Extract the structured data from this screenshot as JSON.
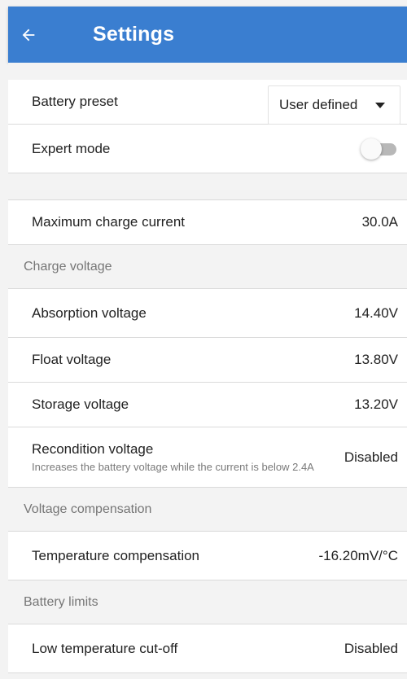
{
  "header": {
    "title": "Settings",
    "back_icon": "arrow-left-icon"
  },
  "colors": {
    "app_bar": "#3a7ed0",
    "section_bg": "#f3f3f3",
    "toggle_off": "#b8b8b8"
  },
  "general": {
    "battery_preset": {
      "label": "Battery preset",
      "value": "User defined",
      "icon": "caret-down-icon"
    },
    "expert_mode": {
      "label": "Expert mode",
      "state": "off"
    }
  },
  "current": {
    "max_charge_current": {
      "label": "Maximum charge current",
      "value": "30.0A"
    }
  },
  "charge_voltage": {
    "header": "Charge voltage",
    "absorption": {
      "label": "Absorption voltage",
      "value": "14.40V"
    },
    "float": {
      "label": "Float voltage",
      "value": "13.80V"
    },
    "storage": {
      "label": "Storage voltage",
      "value": "13.20V"
    },
    "recondition": {
      "label": "Recondition voltage",
      "description": "Increases the battery voltage while the current is below 2.4A",
      "value": "Disabled"
    }
  },
  "voltage_compensation": {
    "header": "Voltage compensation",
    "temperature": {
      "label": "Temperature compensation",
      "value": "-16.20mV/°C"
    }
  },
  "battery_limits": {
    "header": "Battery limits",
    "low_temp_cutoff": {
      "label": "Low temperature cut-off",
      "value": "Disabled"
    }
  }
}
